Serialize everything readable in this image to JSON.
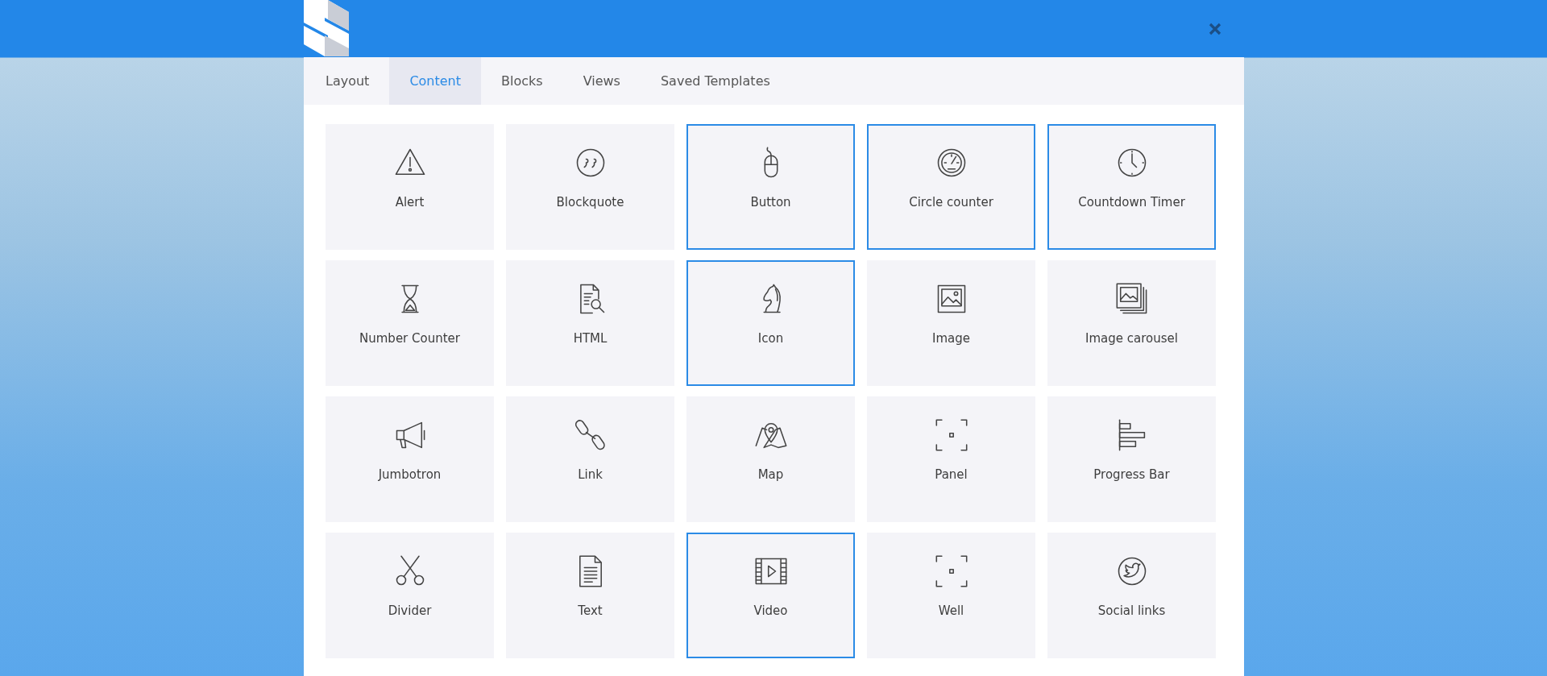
{
  "tabs": [
    {
      "label": "Layout",
      "selected": false
    },
    {
      "label": "Content",
      "selected": true
    },
    {
      "label": "Blocks",
      "selected": false
    },
    {
      "label": "Views",
      "selected": false
    },
    {
      "label": "Saved Templates",
      "selected": false
    }
  ],
  "tiles": [
    {
      "label": "Alert",
      "kind": "warning",
      "selected": false
    },
    {
      "label": "Blockquote",
      "kind": "quote",
      "selected": false
    },
    {
      "label": "Button",
      "kind": "mouse",
      "selected": true
    },
    {
      "label": "Circle counter",
      "kind": "gauge",
      "selected": true
    },
    {
      "label": "Countdown Timer",
      "kind": "clock",
      "selected": true
    },
    {
      "label": "Number Counter",
      "kind": "hourglass",
      "selected": false
    },
    {
      "label": "HTML",
      "kind": "docsearch",
      "selected": false
    },
    {
      "label": "Icon",
      "kind": "knight",
      "selected": true
    },
    {
      "label": "Image",
      "kind": "image",
      "selected": false
    },
    {
      "label": "Image carousel",
      "kind": "images",
      "selected": false
    },
    {
      "label": "Jumbotron",
      "kind": "megaphone",
      "selected": false
    },
    {
      "label": "Link",
      "kind": "link",
      "selected": false
    },
    {
      "label": "Map",
      "kind": "map",
      "selected": false
    },
    {
      "label": "Panel",
      "kind": "frame",
      "selected": false
    },
    {
      "label": "Progress Bar",
      "kind": "bars",
      "selected": false
    },
    {
      "label": "Divider",
      "kind": "scissors",
      "selected": false
    },
    {
      "label": "Text",
      "kind": "document",
      "selected": false
    },
    {
      "label": "Video",
      "kind": "film",
      "selected": true
    },
    {
      "label": "Well",
      "kind": "frame",
      "selected": false
    },
    {
      "label": "Social links",
      "kind": "bird",
      "selected": false
    }
  ]
}
